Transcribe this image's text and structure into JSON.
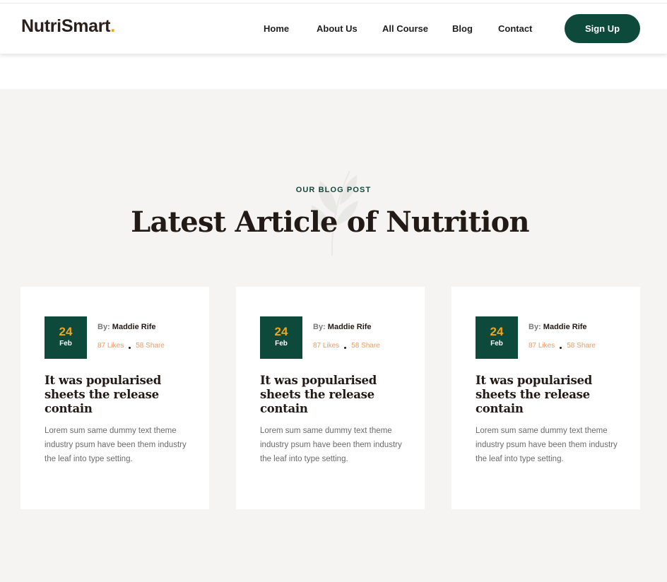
{
  "brand": {
    "name": "NutriSmart",
    "dot": ".",
    "dot_color": "#f2a516"
  },
  "nav": {
    "items": [
      "Home",
      "About Us",
      "All Course",
      "Blog",
      "Contact"
    ],
    "signup_label": "Sign Up"
  },
  "colors": {
    "primary": "#0d4a3c",
    "accent": "#f2a516",
    "stats": "#f09a63",
    "section_bg": "#f5f4f2"
  },
  "section": {
    "eyebrow": "OUR BLOG POST",
    "title": "Latest Article of Nutrition"
  },
  "posts": [
    {
      "day": "24",
      "month": "Feb",
      "by_label": "By:",
      "author": "Maddie Rife",
      "likes": "87 Likes",
      "shares": "58 Share",
      "title": "It was popularised sheets the release contain",
      "excerpt": "Lorem sum same dummy text theme industry psum have been them industry the leaf into type setting."
    },
    {
      "day": "24",
      "month": "Feb",
      "by_label": "By:",
      "author": "Maddie Rife",
      "likes": "87 Likes",
      "shares": "58 Share",
      "title": "It was popularised sheets the release contain",
      "excerpt": "Lorem sum same dummy text theme industry psum have been them industry the leaf into type setting."
    },
    {
      "day": "24",
      "month": "Feb",
      "by_label": "By:",
      "author": "Maddie Rife",
      "likes": "87 Likes",
      "shares": "58 Share",
      "title": "It was popularised sheets the release contain",
      "excerpt": "Lorem sum same dummy text theme industry psum have been them industry the leaf into type setting."
    }
  ]
}
